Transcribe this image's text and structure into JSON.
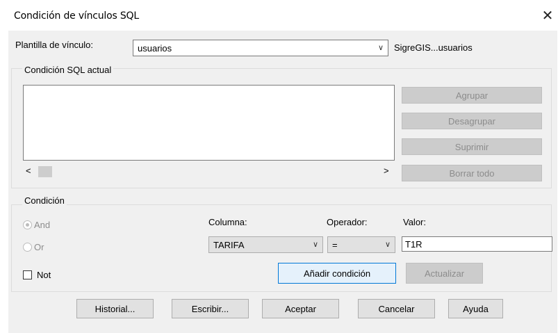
{
  "window": {
    "title": "Condición de vínculos SQL",
    "close_glyph": "✕"
  },
  "template": {
    "label": "Plantilla de vínculo:",
    "value": "usuarios",
    "target": "SigreGIS...usuarios"
  },
  "current_sql": {
    "group_label": "Condición SQL actual",
    "buttons": {
      "group": "Agrupar",
      "ungroup": "Desagrupar",
      "delete": "Suprimir",
      "clear_all": "Borrar todo"
    },
    "scroll_left": "<",
    "scroll_right": ">"
  },
  "condition": {
    "group_label": "Condición",
    "and_label": "And",
    "or_label": "Or",
    "not_label": "Not",
    "column_label": "Columna:",
    "operator_label": "Operador:",
    "value_label": "Valor:",
    "column_value": "TARIFA",
    "operator_value": "=",
    "value": "T1R",
    "add_button": "Añadir condición",
    "update_button": "Actualizar"
  },
  "footer": {
    "history": "Historial...",
    "write": "Escribir...",
    "accept": "Aceptar",
    "cancel": "Cancelar",
    "help": "Ayuda"
  },
  "icons": {
    "combo_caret": "chevron-down-icon",
    "close": "close-icon"
  }
}
